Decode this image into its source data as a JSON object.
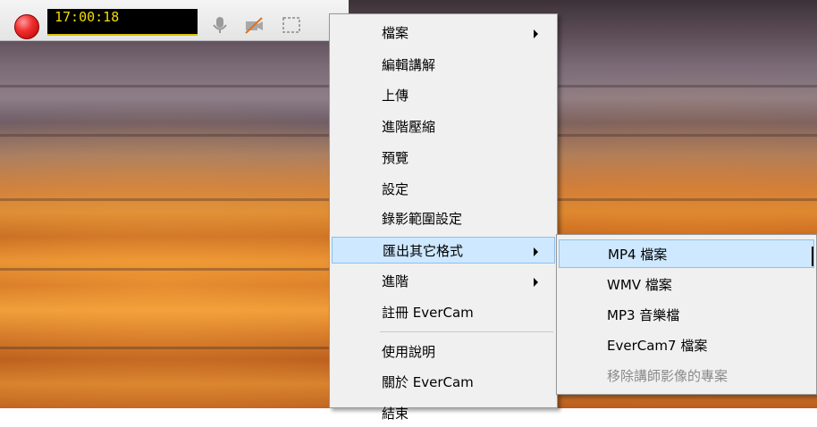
{
  "toolbar": {
    "timer": "17:00:18",
    "icons": [
      "record-icon",
      "microphone-icon",
      "camera-off-icon",
      "region-select-icon"
    ]
  },
  "menu": {
    "items": [
      {
        "label": "檔案",
        "has_submenu": true
      },
      {
        "label": "編輯講解"
      },
      {
        "label": "上傳"
      },
      {
        "label": "進階壓縮"
      },
      {
        "label": "預覽"
      },
      {
        "label": "設定"
      },
      {
        "label": "錄影範圍設定"
      },
      {
        "label": "匯出其它格式",
        "has_submenu": true,
        "highlighted": true
      },
      {
        "label": "進階",
        "has_submenu": true
      },
      {
        "label": "註冊 EverCam"
      },
      {
        "label": "使用說明"
      },
      {
        "label": "關於 EverCam"
      },
      {
        "label": "結束"
      }
    ]
  },
  "submenu": {
    "items": [
      {
        "label": "MP4 檔案",
        "highlighted": true
      },
      {
        "label": "WMV 檔案"
      },
      {
        "label": "MP3 音樂檔"
      },
      {
        "label": "EverCam7 檔案"
      },
      {
        "label": "移除講師影像的專案",
        "disabled": true
      }
    ]
  },
  "colors": {
    "highlight": "#cde8ff",
    "timer_text": "#f2dc00",
    "record": "#f03030"
  }
}
